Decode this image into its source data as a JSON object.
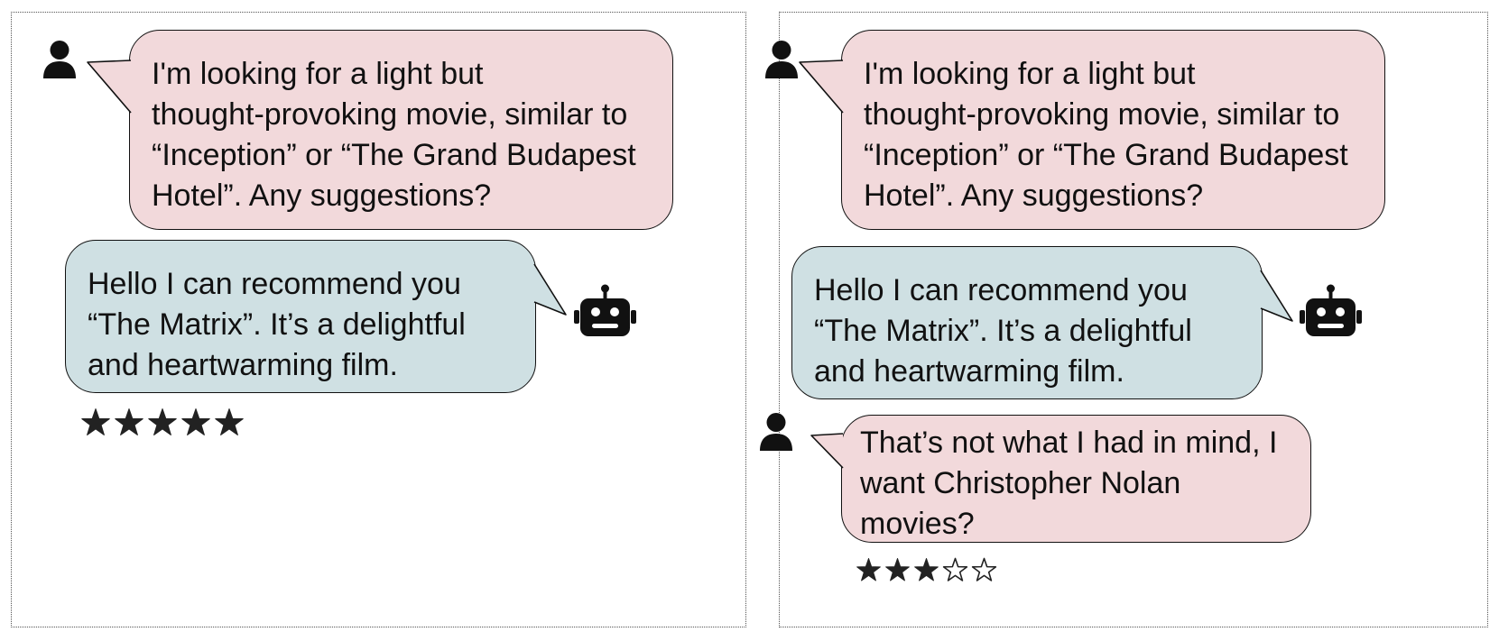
{
  "colors": {
    "user_bubble": "#f2d9db",
    "bot_bubble": "#cfe0e3",
    "outline": "#111111",
    "star": "#222222"
  },
  "icons": {
    "user": "user-icon",
    "bot": "robot-icon",
    "star_filled": "star-filled-icon",
    "star_empty": "star-outline-icon"
  },
  "panels": [
    {
      "messages": [
        {
          "role": "user",
          "text": "I'm looking for a light but\nthought-provoking movie, similar to\n“Inception” or “The Grand Budapest\nHotel”. Any suggestions?"
        },
        {
          "role": "bot",
          "text": "Hello I can recommend you\n“The Matrix”. It’s a delightful\nand heartwarming film."
        }
      ],
      "rating": {
        "value": 5,
        "max": 5
      }
    },
    {
      "messages": [
        {
          "role": "user",
          "text": "I'm looking for a light but\nthought-provoking movie, similar to\n“Inception” or “The Grand Budapest\nHotel”. Any suggestions?"
        },
        {
          "role": "bot",
          "text": "Hello I can recommend you\n“The Matrix”. It’s a delightful\nand heartwarming film."
        },
        {
          "role": "user",
          "text": "That’s not what I had in mind, I\nwant Christopher Nolan\nmovies?"
        }
      ],
      "rating": {
        "value": 3,
        "max": 5
      }
    }
  ]
}
